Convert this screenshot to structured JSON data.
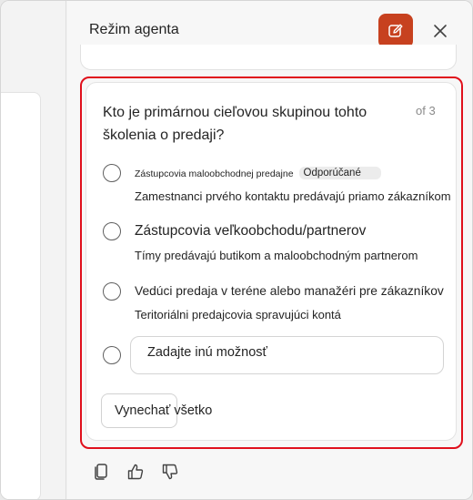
{
  "header": {
    "title": "Režim agenta",
    "new_chat_icon": "compose-icon",
    "close_icon": "close-icon"
  },
  "question": {
    "text": "Kto je primárnou cieľovou skupinou tohto školenia o predaji?",
    "counter": "of 3",
    "options": [
      {
        "title": "Zástupcovia maloobchodnej predajne",
        "badge": "Odporúčané",
        "description": "Zamestnanci prvého kontaktu predávajú priamo zákazníkom"
      },
      {
        "title": "Zástupcovia veľkoobchodu/partnerov",
        "description": "Tímy predávajú butikom a maloobchodným partnerom"
      },
      {
        "title": "Vedúci predaja v teréne alebo manažéri pre zákazníkov",
        "description": "Teritoriálni predajcovia spravujúci kontá"
      }
    ],
    "other_placeholder": "Zadajte inú možnosť",
    "skip_label": "Vynechať všetko"
  },
  "actions": [
    "copy-icon",
    "thumbs-up-icon",
    "thumbs-down-icon"
  ],
  "colors": {
    "accent": "#c7411f",
    "highlight": "#e0101c"
  }
}
